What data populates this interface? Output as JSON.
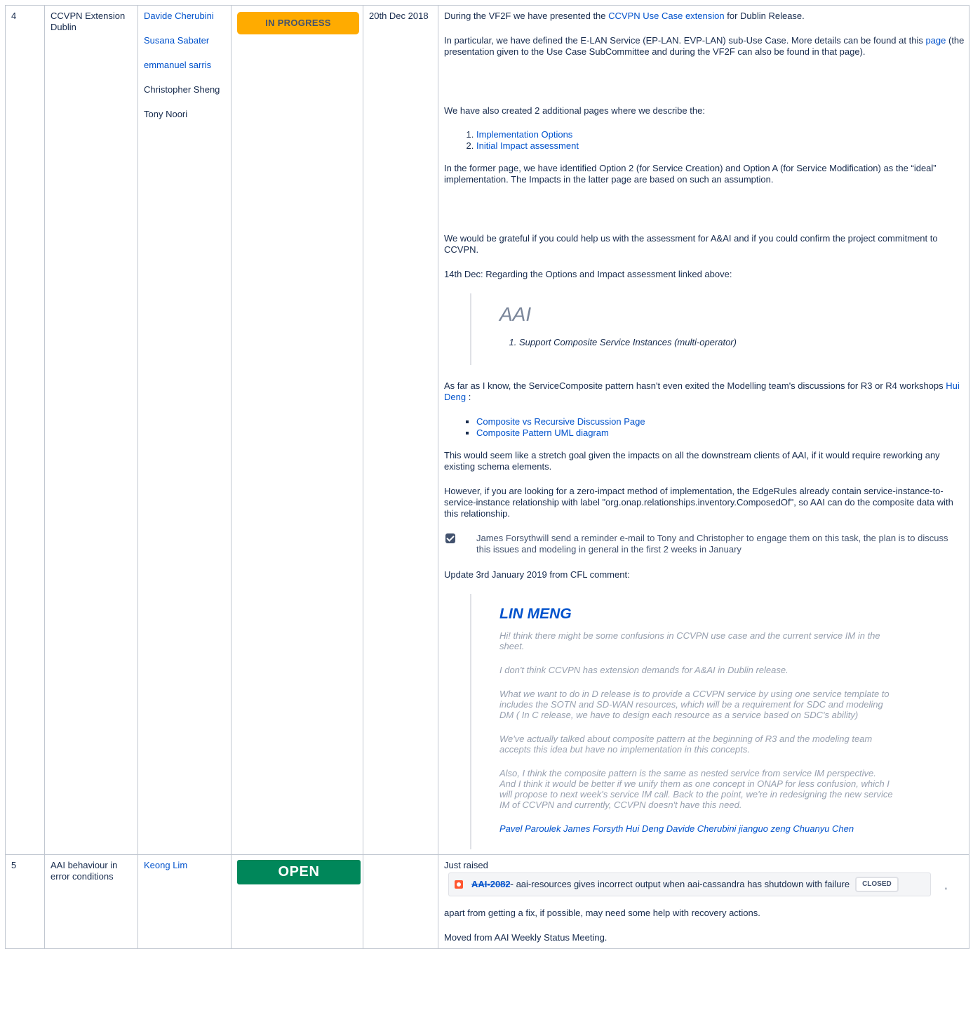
{
  "rows": [
    {
      "num": "4",
      "title": "CCVPN Extension Dublin",
      "owners_linked": [
        "Davide Cherubini",
        "Susana Sabater",
        "emmanuel sarris"
      ],
      "owners_plain": [
        "Christopher Sheng",
        "Tony Noori"
      ],
      "status": "IN PROGRESS",
      "date": "20th Dec 2018",
      "notes": {
        "p1_pre": "During the VF2F we have presented the ",
        "p1_link": "CCVPN Use Case extension",
        "p1_post": " for Dublin Release.",
        "p2_pre": "In particular, we have defined the E-LAN Service (EP-LAN. EVP-LAN) sub-Use Case. More details can be found at this ",
        "p2_link": "page",
        "p2_post": " (the presentation given to the Use Case SubCommittee and during the VF2F can also be found in that page).",
        "p3": "We have also created 2 additional pages where we describe the:",
        "options": [
          "Implementation Options",
          "Initial Impact assessment"
        ],
        "p4": "In the former page, we have identified Option 2 (for Service Creation) and Option A (for Service Modification) as the “ideal” implementation. The Impacts in the latter page are based on such an assumption.",
        "p5": "We would be grateful if you could help us with the assessment for A&AI and if you could confirm the project commitment to CCVPN.",
        "p6": "14th Dec: Regarding the Options and Impact assessment linked above:",
        "quote_title": "AAI",
        "quote_item": "Support Composite Service Instances (multi-operator)",
        "p7_pre": "As far as I know, the ServiceComposite pattern hasn't even exited the Modelling team's discussions for R3 or R4 workshops ",
        "p7_link": "Hui Deng",
        "p7_post": " :",
        "links": [
          "Composite vs Recursive Discussion Page",
          "Composite Pattern UML diagram"
        ],
        "p8": "This would seem like a stretch goal given the impacts on all the downstream clients of AAI, if it would require reworking any existing schema elements.",
        "p9": "However, if you are looking for a zero-impact method of implementation, the EdgeRules already contain service-instance-to-service-instance relationship with label \"org.onap.relationships.inventory.ComposedOf\", so AAI can do the composite data with this relationship.",
        "task": "James Forsythwill send a reminder e-mail to Tony and Christopher to engage them on this task, the plan is to discuss this issues and modeling in general in the first 2 weeks in January",
        "p10": "Update 3rd January 2019 from CFL comment:",
        "q2_title": "LIN MENG",
        "q2_paras": [
          "Hi! think there might be some confusions in CCVPN use case and the current service IM in the sheet.",
          "I don't think CCVPN has extension demands for A&AI in Dublin release.",
          "What we want to do in D release is to provide a CCVPN service by using one service template to includes the SOTN and SD-WAN resources, which will be a requirement for SDC and modeling DM ( In C release, we have to design each  resource as a service based on SDC's ability)",
          "We've actually talked about composite pattern at the beginning of R3 and the modeling team accepts this idea but have no implementation in this concepts.",
          "Also, I think the composite pattern is the same as nested service from service IM perspective. And I think it would be better if we unify them as one concept in ONAP for less confusion, which I will propose to next week's service IM call. Back to the point, we're in redesigning the new service IM of CCVPN and  currently, CCVPN doesn't have this need."
        ],
        "q2_mentions": "Pavel Paroulek  James Forsyth  Hui Deng  Davide Cherubini jianguo zeng Chuanyu Chen"
      }
    },
    {
      "num": "5",
      "title": "AAI behaviour in error conditions",
      "owner": "Keong Lim",
      "status": "OPEN",
      "date": "",
      "notes": {
        "p1": "Just raised",
        "jira_key": "AAI-2082",
        "jira_summary": " - aai-resources gives incorrect output when aai-cassandra has shutdown with failure",
        "jira_status": "CLOSED",
        "jira_trailing": ",",
        "p2": "apart from getting a fix, if possible, may need some help with recovery actions.",
        "p3": "Moved from AAI Weekly Status Meeting."
      }
    }
  ],
  "colors": {
    "link": "#0052cc",
    "in_progress": "#ffab00",
    "open": "#00875a",
    "border": "#c1c7d0"
  }
}
